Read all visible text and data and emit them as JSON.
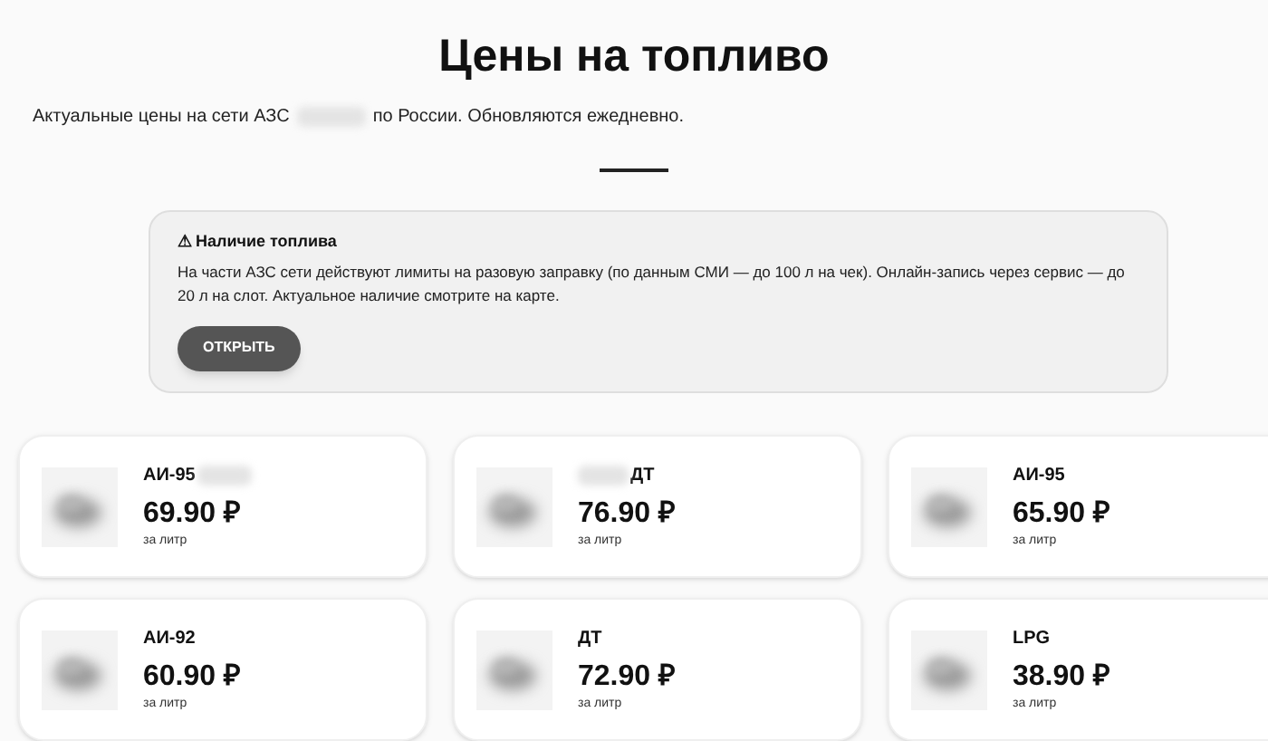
{
  "title": "Цены на топливо",
  "subtitle": {
    "before": "Актуальные цены на сети АЗС",
    "after": "по России. Обновляются ежедневно."
  },
  "notice": {
    "icon": "⚠",
    "title": "Наличие топлива",
    "text": "На части АЗС сети действуют лимиты на разовую заправку (по данным СМИ — до 100 л на чек). Онлайн-запись через сервис — до 20 л на слот. Актуальное наличие смотрите на карте.",
    "button": "ОТКРЫТЬ"
  },
  "fuels": [
    {
      "name": "АИ-95",
      "blurred_before": false,
      "blurred_after": true,
      "price": "69.90 ₽",
      "unit": "за литр"
    },
    {
      "name": "ДТ",
      "blurred_before": true,
      "blurred_after": false,
      "price": "76.90 ₽",
      "unit": "за литр"
    },
    {
      "name": "АИ-95",
      "blurred_before": false,
      "blurred_after": false,
      "price": "65.90 ₽",
      "unit": "за литр"
    },
    {
      "name": "АИ-92",
      "blurred_before": false,
      "blurred_after": false,
      "price": "60.90 ₽",
      "unit": "за литр"
    },
    {
      "name": "ДТ",
      "blurred_before": false,
      "blurred_after": false,
      "price": "72.90 ₽",
      "unit": "за литр"
    },
    {
      "name": "LPG",
      "blurred_before": false,
      "blurred_after": false,
      "price": "38.90 ₽",
      "unit": "за литр"
    }
  ]
}
